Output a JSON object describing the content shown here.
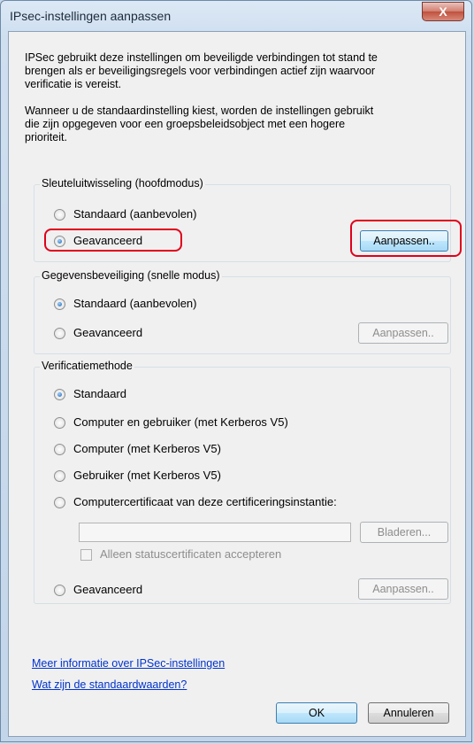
{
  "window": {
    "title": "IPsec-instellingen aanpassen",
    "close_glyph": "X"
  },
  "intro": {
    "line1": "IPSec gebruikt deze instellingen om beveiligde verbindingen tot stand te",
    "line2": "brengen als er beveiligingsregels voor verbindingen actief zijn waarvoor",
    "line3": "verificatie is vereist.",
    "line4": "Wanneer u de standaardinstelling kiest, worden de instellingen gebruikt",
    "line5": "die zijn opgegeven voor een groepsbeleidsobject met een hogere",
    "line6": "prioriteit."
  },
  "key_exchange": {
    "label": "Sleuteluitwisseling (hoofdmodus)",
    "option_default": "Standaard (aanbevolen)",
    "option_advanced": "Geavanceerd",
    "selected": "Geavanceerd",
    "customize": "Aanpassen.."
  },
  "data_protection": {
    "label": "Gegevensbeveiliging (snelle modus)",
    "option_default": "Standaard (aanbevolen)",
    "option_advanced": "Geavanceerd",
    "selected": "Standaard (aanbevolen)",
    "customize": "Aanpassen.."
  },
  "auth": {
    "label": "Verificatiemethode",
    "option_default": "Standaard",
    "option_computer_user": "Computer en gebruiker (met Kerberos V5)",
    "option_computer": "Computer (met Kerberos V5)",
    "option_user": "Gebruiker (met Kerberos V5)",
    "option_cert": "Computercertificaat van deze certificeringsinstantie:",
    "cert_value": "",
    "browse": "Bladeren...",
    "health_only": "Alleen statuscertificaten accepteren",
    "option_advanced": "Geavanceerd",
    "customize": "Aanpassen..",
    "selected": "Standaard"
  },
  "links": {
    "more_info": "Meer informatie over IPSec-instellingen",
    "defaults": "Wat zijn de standaardwaarden?"
  },
  "buttons": {
    "ok": "OK",
    "cancel": "Annuleren"
  },
  "colors": {
    "highlight": "#e0001a",
    "link": "#0033cc"
  }
}
